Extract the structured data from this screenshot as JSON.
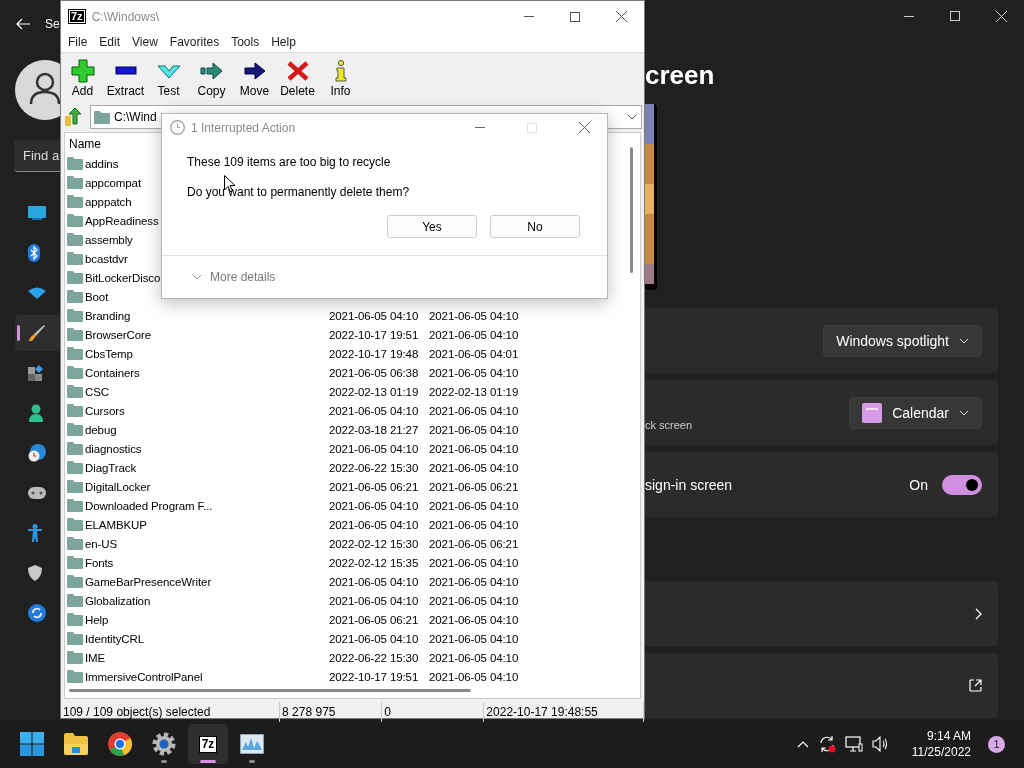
{
  "settings_window": {
    "title": "Se",
    "search": {
      "placeholder": "Find a"
    },
    "nav": [
      {
        "kind": "display",
        "selected": false
      },
      {
        "kind": "bluetooth",
        "selected": false
      },
      {
        "kind": "network",
        "selected": false
      },
      {
        "kind": "personalization",
        "selected": true
      },
      {
        "kind": "apps",
        "selected": false
      },
      {
        "kind": "accounts",
        "selected": false
      },
      {
        "kind": "time",
        "selected": false
      },
      {
        "kind": "gaming",
        "selected": false
      },
      {
        "kind": "accessibility",
        "selected": false
      },
      {
        "kind": "privacy",
        "selected": false
      },
      {
        "kind": "update",
        "selected": false
      }
    ],
    "page_title": "creen",
    "cards": [
      {
        "kind": "dropdown",
        "value": "Windows spotlight"
      },
      {
        "kind": "dropdown_icon",
        "caption": "ck screen",
        "value": "Calendar"
      },
      {
        "kind": "toggle",
        "caption": "sign-in screen",
        "state_label": "On",
        "on": true
      },
      {
        "kind": "nav"
      },
      {
        "kind": "external"
      }
    ]
  },
  "archive_window": {
    "logo": "7z",
    "title": "C:\\Windows\\",
    "menu": [
      "File",
      "Edit",
      "View",
      "Favorites",
      "Tools",
      "Help"
    ],
    "toolbar": [
      {
        "kind": "add",
        "label": "Add"
      },
      {
        "kind": "extract",
        "label": "Extract"
      },
      {
        "kind": "test",
        "label": "Test"
      },
      {
        "kind": "copy",
        "label": "Copy"
      },
      {
        "kind": "move",
        "label": "Move"
      },
      {
        "kind": "delete",
        "label": "Delete"
      },
      {
        "kind": "info",
        "label": "Info"
      }
    ],
    "address": "C:\\Wind",
    "table": {
      "columns": [
        "Name"
      ],
      "rows": [
        {
          "name": "addins"
        },
        {
          "name": "appcompat"
        },
        {
          "name": "apppatch"
        },
        {
          "name": "AppReadiness"
        },
        {
          "name": "assembly"
        },
        {
          "name": "bcastdvr"
        },
        {
          "name": "BitLockerDisco"
        },
        {
          "name": "Boot"
        },
        {
          "name": "Branding",
          "column_2": "2021-06-05 04:10",
          "column_3": "2021-06-05 04:10"
        },
        {
          "name": "BrowserCore",
          "column_2": "2022-10-17 19:51",
          "column_3": "2021-06-05 04:10"
        },
        {
          "name": "CbsTemp",
          "column_2": "2022-10-17 19:48",
          "column_3": "2021-06-05 04:01"
        },
        {
          "name": "Containers",
          "column_2": "2021-06-05 06:38",
          "column_3": "2021-06-05 04:10"
        },
        {
          "name": "CSC",
          "column_2": "2022-02-13 01:19",
          "column_3": "2022-02-13 01:19"
        },
        {
          "name": "Cursors",
          "column_2": "2021-06-05 04:10",
          "column_3": "2021-06-05 04:10"
        },
        {
          "name": "debug",
          "column_2": "2022-03-18 21:27",
          "column_3": "2021-06-05 04:10"
        },
        {
          "name": "diagnostics",
          "column_2": "2021-06-05 04:10",
          "column_3": "2021-06-05 04:10"
        },
        {
          "name": "DiagTrack",
          "column_2": "2022-06-22 15:30",
          "column_3": "2021-06-05 04:10"
        },
        {
          "name": "DigitalLocker",
          "column_2": "2021-06-05 06:21",
          "column_3": "2021-06-05 06:21"
        },
        {
          "name": "Downloaded Program F...",
          "column_2": "2021-06-05 04:10",
          "column_3": "2021-06-05 04:10"
        },
        {
          "name": "ELAMBKUP",
          "column_2": "2021-06-05 04:10",
          "column_3": "2021-06-05 04:10"
        },
        {
          "name": "en-US",
          "column_2": "2022-02-12 15:30",
          "column_3": "2021-06-05 06:21"
        },
        {
          "name": "Fonts",
          "column_2": "2022-02-12 15:35",
          "column_3": "2021-06-05 04:10"
        },
        {
          "name": "GameBarPresenceWriter",
          "column_2": "2021-06-05 04:10",
          "column_3": "2021-06-05 04:10"
        },
        {
          "name": "Globalization",
          "column_2": "2021-06-05 04:10",
          "column_3": "2021-06-05 04:10"
        },
        {
          "name": "Help",
          "column_2": "2021-06-05 06:21",
          "column_3": "2021-06-05 04:10"
        },
        {
          "name": "IdentityCRL",
          "column_2": "2021-06-05 04:10",
          "column_3": "2021-06-05 04:10"
        },
        {
          "name": "IME",
          "column_2": "2022-06-22 15:30",
          "column_3": "2021-06-05 04:10"
        },
        {
          "name": "ImmersiveControlPanel",
          "column_2": "2022-10-17 19:51",
          "column_3": "2021-06-05 04:10"
        }
      ]
    },
    "status_bar": [
      "109 / 109 object(s) selected",
      "8 278 975",
      "0",
      "2022-10-17 19:48:55"
    ]
  },
  "dialog": {
    "title": "1 Interrupted Action",
    "messages": [
      "These 109 items are too big to recycle",
      "Do you want to permanently delete them?"
    ],
    "buttons": [
      "Yes",
      "No"
    ],
    "details": "More details"
  },
  "taskbar": {
    "apps": [
      {
        "kind": "start",
        "active": false,
        "running": false
      },
      {
        "kind": "explorer",
        "active": false,
        "running": false
      },
      {
        "kind": "browser",
        "active": false,
        "running": false
      },
      {
        "kind": "settings",
        "active": false,
        "running": true
      },
      {
        "kind": "archiver",
        "label": "7z",
        "active": true,
        "running": true
      },
      {
        "kind": "monitor",
        "active": false,
        "running": true
      }
    ],
    "time": "9:14 AM",
    "date": "11/25/2022",
    "notifications": "1"
  }
}
